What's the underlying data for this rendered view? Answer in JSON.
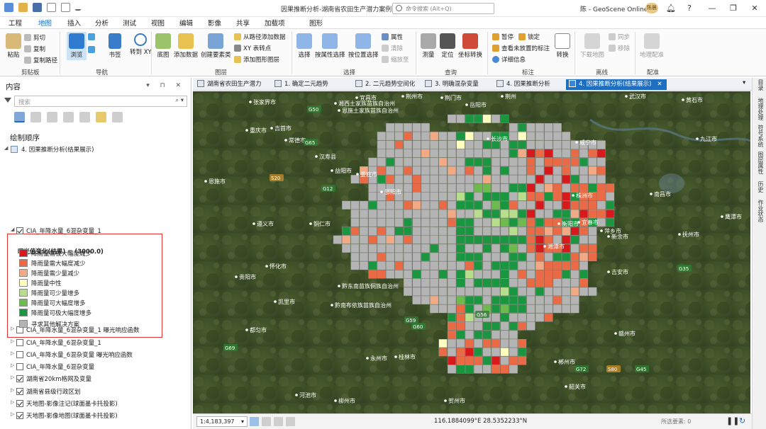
{
  "app": {
    "title": "因果推断分析-湖南省农田生产潜力案例",
    "command_search_placeholder": "命令搜索 (Alt+Q)",
    "user": "陈 - GeoScene Online",
    "avatar": "陈晨",
    "window_buttons": [
      "?",
      "—",
      "❐",
      "✕"
    ]
  },
  "menu": {
    "tabs": [
      "工程",
      "地图",
      "插入",
      "分析",
      "测试",
      "视图",
      "编辑",
      "影像",
      "共享",
      "加载项",
      "图形"
    ],
    "active": "地图"
  },
  "ribbon": {
    "clipboard": {
      "paste": "粘贴",
      "cut": "剪切",
      "copy": "复制",
      "copy_path": "复制路径",
      "group": "剪贴板"
    },
    "navigate": {
      "explore": "浏览",
      "bookmarks": "书签",
      "goto_xy": "转到\nXY",
      "group": "导航"
    },
    "layer": {
      "basemap": "底图",
      "add_data": "添加数据",
      "create_layer": "创建要素类",
      "add_from_path": "从路径添加数据",
      "xy_point": "XY 表转点",
      "add_graphics": "添加图形图层",
      "group": "图层"
    },
    "selection": {
      "select": "选择",
      "select_by_attr": "按属性选择",
      "select_by_loc": "按位置选择",
      "attributes": "属性",
      "clear": "清除",
      "zoom_to": "缩放至",
      "group": "选择"
    },
    "inquiry": {
      "measure": "测量",
      "locate": "定位",
      "coordinate": "坐标转换",
      "group": "查询"
    },
    "labeling": {
      "pause": "暂停",
      "lock": "锁定",
      "view_unplaced": "查看未放置的标注",
      "more": "详细信息",
      "convert": "转换",
      "group": "标注"
    },
    "offline": {
      "download": "下载地图",
      "sync": "同步",
      "remove": "移除",
      "group": "离线"
    },
    "georef": {
      "georeference": "地理配准",
      "group": "配准"
    }
  },
  "contents": {
    "title": "内容",
    "search_placeholder": "搜索",
    "draw_order": "绘制顺序",
    "map_name": "4. 因果推断分析(结果展示)",
    "layers": [
      {
        "name": "CIA_年降水量_6混杂变量_1",
        "checked": true,
        "expanded": true
      },
      {
        "name": "CIA_年降水量_6混杂变量_1 曝光响应函数",
        "checked": false
      },
      {
        "name": "CIA_年降水量_6混杂变量_1",
        "checked": false
      },
      {
        "name": "CIA_年降水量_6混杂变量 曝光响应函数",
        "checked": false
      },
      {
        "name": "CIA_年降水量_6混杂变量",
        "checked": false
      },
      {
        "name": "湖南省20km格网及变量",
        "checked": true
      },
      {
        "name": "湖南省县级行政区划",
        "checked": true
      },
      {
        "name": "天地图-影像注记(球面墨卡托投影)",
        "checked": true
      },
      {
        "name": "天地图-影像地图(球面墨卡托投影)",
        "checked": true
      }
    ],
    "legend": {
      "heading": "曝光值变化(结果) = (3000.0)",
      "classes": [
        {
          "label": "降雨量需极大幅度减少",
          "color": "#d7191c"
        },
        {
          "label": "降雨量需大幅度减少",
          "color": "#ea6a45"
        },
        {
          "label": "降雨量需少量减少",
          "color": "#f4a985"
        },
        {
          "label": "降雨量中性",
          "color": "#ffffbf"
        },
        {
          "label": "降雨量可少量增多",
          "color": "#b7de8c"
        },
        {
          "label": "降雨量可大幅度增多",
          "color": "#6dbb4f"
        },
        {
          "label": "降雨量可极大幅度增多",
          "color": "#1a9641"
        },
        {
          "label": "寻求其他解决方案",
          "color": "#b4b4b4"
        }
      ]
    }
  },
  "doc_tabs": [
    "湖南省农田生产潜力",
    "1. 确定二元趋势",
    "2. 二元趋势空间化",
    "3. 明确混杂变量",
    "4. 因果推断分析",
    "4. 因果推断分析(结果展示)"
  ],
  "doc_tab_active": 5,
  "map": {
    "places": [
      "常德市",
      "岳阳市",
      "荆州市",
      "汉寿县",
      "益阳市",
      "长沙市",
      "湘潭市",
      "株洲市",
      "娄底市",
      "邵阳市",
      "衡阳市",
      "郴州市",
      "永州市",
      "怀化市",
      "吉首市",
      "张家界市",
      "南昌市",
      "宜春市",
      "萍乡市",
      "吉安市",
      "赣州市",
      "韶关市",
      "桂林市",
      "贵阳市",
      "重庆市",
      "恩施市",
      "遵义市",
      "铜仁市",
      "凯里市",
      "都匀市",
      "河池市",
      "柳州市",
      "贺州市",
      "咸宁市",
      "黄石市",
      "武汉市",
      "九江市",
      "鹰潭市",
      "抚州市",
      "新余市",
      "荆门市",
      "宜昌市",
      "荆州",
      "黔东南苗族侗族自治州",
      "黔南布依族苗族自治州",
      "湘西土家族苗族自治州",
      "恩施土家族苗族自治州"
    ],
    "roads": [
      "G50",
      "G65",
      "G56",
      "G12",
      "G60",
      "G59",
      "G69",
      "G72",
      "G35",
      "G45",
      "S20",
      "S80"
    ]
  },
  "status": {
    "scale": "1:4,183,397",
    "coordinates": "116.1884099°E 28.5352233°N",
    "selected_features": "所选要素: 0"
  },
  "right_tabs": [
    "目录",
    "地理处理",
    "符号系统",
    "图层属性",
    "历史",
    "作业状态"
  ]
}
